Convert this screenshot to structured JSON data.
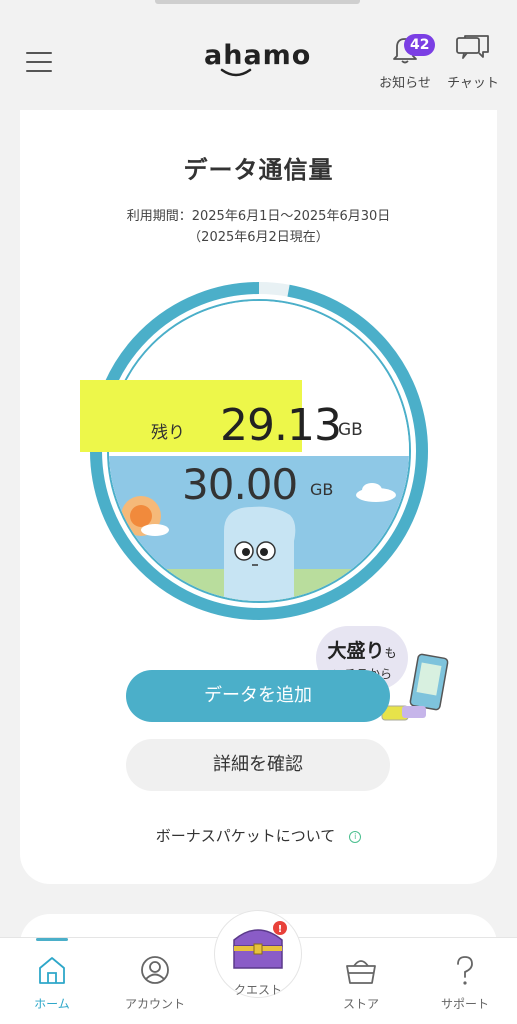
{
  "header": {
    "logo": "ahamo",
    "notifications": {
      "label": "お知らせ",
      "count": "42"
    },
    "chat": {
      "label": "チャット"
    }
  },
  "usage": {
    "title": "データ通信量",
    "period_line1": "利用期間：2025年6月1日〜2025年6月30日",
    "period_line2": "（2025年6月2日現在）",
    "remaining_label": "残り",
    "remaining_value": "29.13",
    "remaining_unit": "GB",
    "total_value": "30.00",
    "total_unit": "GB",
    "remaining_fraction": 0.971
  },
  "promo": {
    "main": "大盛り",
    "suffix": "も",
    "sub": "コチラから"
  },
  "actions": {
    "add_data": "データを追加",
    "details": "詳細を確認",
    "bonus_packet": "ボーナスパケットについて"
  },
  "nav": {
    "items": [
      {
        "label": "ホーム",
        "icon": "home-icon",
        "active": true
      },
      {
        "label": "アカウント",
        "icon": "user-icon",
        "active": false
      },
      {
        "label": "クエスト",
        "icon": "treasure-chest-icon",
        "active": false
      },
      {
        "label": "ストア",
        "icon": "basket-icon",
        "active": false
      },
      {
        "label": "サポート",
        "icon": "question-icon",
        "active": false
      }
    ]
  },
  "colors": {
    "accent": "#4bafc9",
    "badge": "#7b3fe4",
    "highlight": "#edf74a",
    "sky": "#8ec8e6"
  }
}
